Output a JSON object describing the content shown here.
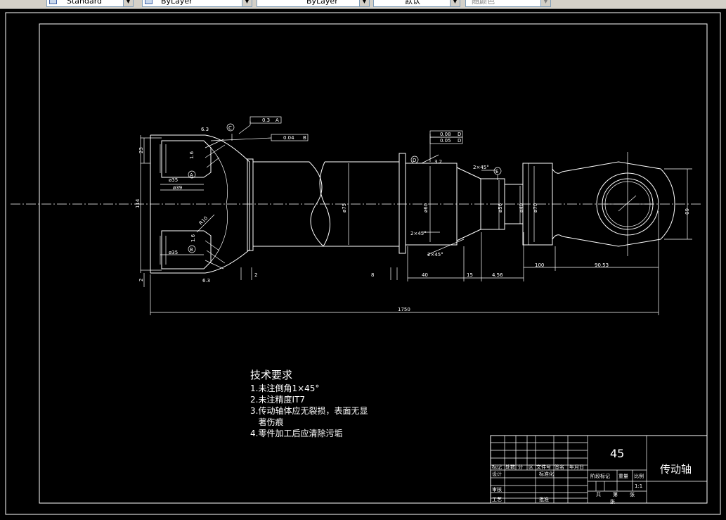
{
  "toolbar": {
    "style_dropdown": "Standard",
    "layer_dropdown": "ByLayer",
    "linetype_dropdown": "ByLayer",
    "lineweight_dropdown": "默认",
    "color_dropdown": "随颜色"
  },
  "drawing": {
    "dimensions": {
      "d23": "23",
      "d114": "114",
      "d1750": "1750",
      "d100": "100",
      "d60": "60",
      "d63_top": "6.3",
      "d63_bottom": "6.3",
      "d16_top": "1.6",
      "d16_bottom": "1.6",
      "phi35_top": "ø35",
      "phi39": "ø39",
      "phi35_bottom": "ø35",
      "phi75": "ø75",
      "phi60": "ø60",
      "phi56": "ø56",
      "phi40": "ø40",
      "phi70": "ø70",
      "r10": "R10",
      "chamfer_1": "2×45°",
      "chamfer_2": "2×45°",
      "chamfer_3": "2×45°",
      "d40": "40",
      "d8": "8",
      "d2": "2",
      "d15": "15",
      "d456": "4.56",
      "d9053": "90.53",
      "r32": "3.2",
      "d2_small": "2"
    },
    "datums": {
      "a": "A",
      "b": "B",
      "c": "C",
      "d": "D",
      "e": "E"
    },
    "tolerances": {
      "t1": "0.3",
      "t1_ref": "A",
      "t2": "0.04",
      "t2_ref": "B",
      "t3": "0.08",
      "t3_ref": "D",
      "t4": "0.05",
      "t4_ref": "D"
    }
  },
  "requirements": {
    "title": "技术要求",
    "items": [
      "1.未注倒角1×45°",
      "2.未注精度IT7",
      "3.传动轴体应无裂损，表面无显",
      "   著伤痕",
      "4.零件加工后应清除污垢"
    ]
  },
  "title_block": {
    "material": "45",
    "part_name": "传动轴",
    "headers": [
      "标记",
      "处数",
      "分",
      "区",
      "文件号",
      "签名",
      "年月日"
    ],
    "row_design": "设计",
    "row_standard": "标准化",
    "row_review": "审核",
    "row_process": "工艺",
    "row_approve": "批准",
    "stage": "阶段标记",
    "weight": "重量",
    "scale_label": "比例",
    "scale": "1:1",
    "sheets_total_1": "共",
    "sheets_total_2": "张",
    "sheets_no_1": "第",
    "sheets_no_2": "张"
  }
}
